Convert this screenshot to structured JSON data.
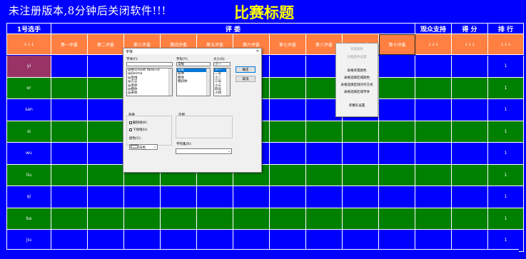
{
  "banner": {
    "notice": "未注册版本,8分钟后关闭软件!!!",
    "title": "比赛标题"
  },
  "header1": {
    "player_col": "1号选手",
    "judges_col": "评 委",
    "audience_col": "观众支持",
    "score_col": "得 分",
    "rank_col": "排 行"
  },
  "header2": {
    "sort_arrows": "↓↓↓",
    "judges": [
      "第一评委",
      "第二评委",
      "第三评委",
      "第四评委",
      "第五评委",
      "第六评委",
      "第七评委",
      "第八评委",
      "第九评委",
      "第十评委"
    ],
    "audience": "↓↓↓",
    "score": "↓↓↓",
    "rank": "↓↓↓"
  },
  "players": [
    {
      "name": "yi",
      "rank": "1"
    },
    {
      "name": "er",
      "rank": "1"
    },
    {
      "name": "san",
      "rank": "1"
    },
    {
      "name": "si",
      "rank": "1"
    },
    {
      "name": "wu",
      "rank": "1"
    },
    {
      "name": "liu",
      "rank": "1"
    },
    {
      "name": "qi",
      "rank": "1"
    },
    {
      "name": "ba",
      "rank": "1"
    },
    {
      "name": "jiu",
      "rank": "1"
    }
  ],
  "colors": {
    "blue_row": "#0000ff",
    "green_row": "#008000",
    "header_orange": "#ff8040",
    "selected_name": "#993366",
    "title_yellow": "#ffff00"
  },
  "font_dialog": {
    "title": "字体",
    "close_glyph": "×",
    "font_label": "字体(F):",
    "font_value": "",
    "fonts": [
      "@Microsoft YaHei UI",
      "@Ebrima",
      "@等线",
      "@方正",
      "@黑体",
      "@楷体",
      "@宋体"
    ],
    "style_label": "字形(Y):",
    "style_value": "常规",
    "styles": [
      "常规",
      "斜体",
      "粗体",
      "粗斜体"
    ],
    "size_label": "大小(S):",
    "size_value": "小一",
    "sizes": [
      "小一",
      "二号",
      "小二",
      "三号",
      "小三",
      "四号",
      "小四"
    ],
    "ok_button": "确定",
    "cancel_button": "取消",
    "effects_label": "效果",
    "strikeout_label": "删除线(K)",
    "underline_label": "下划线(U)",
    "color_label": "颜色(C):",
    "color_value": "白色",
    "sample_label": "示例",
    "script_label": "字符集(R):"
  },
  "context_menu": {
    "items_disabled": [
      "背景颜色",
      "边框颜色设置"
    ],
    "items": [
      "表格背景颜色",
      "表格选择区域颜色",
      "表格选择区域对齐方式",
      "表格选择区域字体"
    ],
    "footer_item": "参赛队设置"
  }
}
